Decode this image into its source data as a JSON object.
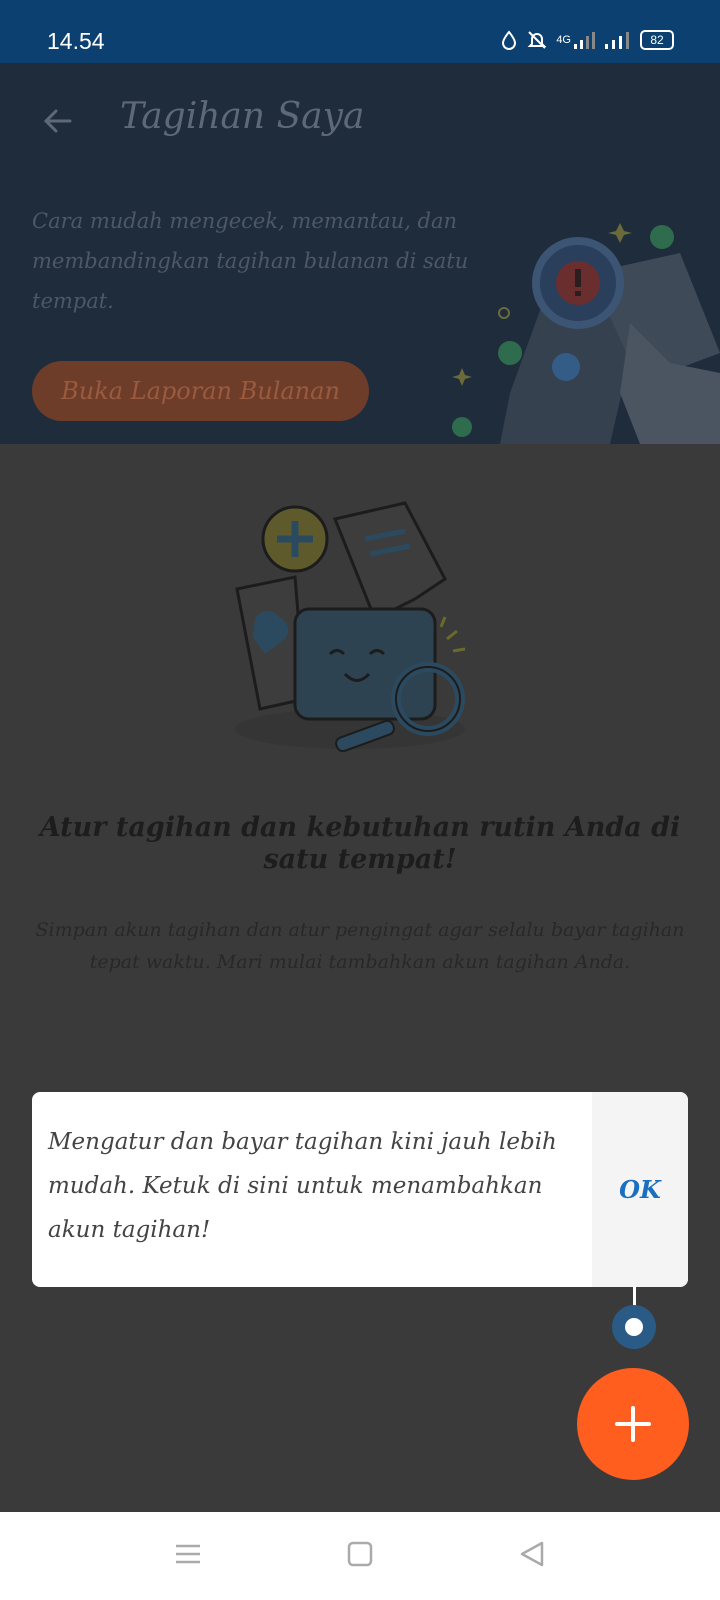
{
  "status_bar": {
    "time": "14.54",
    "network": "4G",
    "battery": "82"
  },
  "header": {
    "title": "Tagihan Saya",
    "description": "Cara mudah mengecek, memantau, dan membandingkan tagihan bulanan di satu tempat.",
    "cta_label": "Buka Laporan Bulanan"
  },
  "empty_state": {
    "heading": "Atur tagihan dan kebutuhan rutin Anda di satu tempat!",
    "subtext": "Simpan akun tagihan dan atur pengingat agar selalu bayar tagihan tepat waktu. Mari mulai tambahkan akun tagihan Anda."
  },
  "tooltip": {
    "message": "Mengatur dan bayar tagihan kini jauh lebih mudah. Ketuk di sini untuk menambahkan akun tagihan!",
    "ok_label": "OK"
  },
  "fab": {
    "icon": "plus-icon"
  },
  "nav_bar": {
    "icons": [
      "menu-icon",
      "home-icon",
      "back-icon"
    ]
  },
  "colors": {
    "status_bar": "#0b4070",
    "header_bg": "#1f2c3c",
    "overlay_bg": "#3a3a3a",
    "fab": "#ff5e1f",
    "ok_text": "#1a6fc1"
  }
}
